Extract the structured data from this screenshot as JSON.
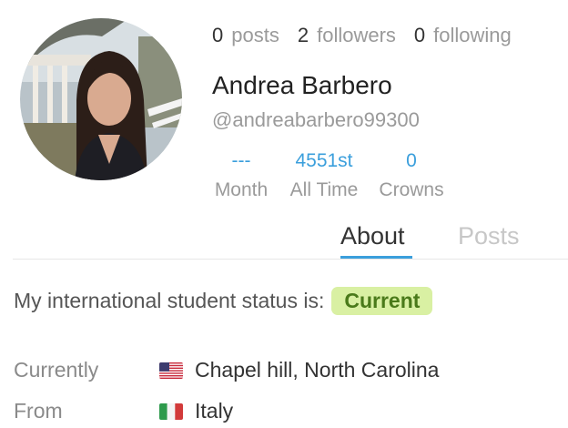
{
  "profile": {
    "posts_count": "0",
    "posts_label": "posts",
    "followers_count": "2",
    "followers_label": "followers",
    "following_count": "0",
    "following_label": "following",
    "name": "Andrea Barbero",
    "handle": "@andreabarbero99300"
  },
  "ranks": [
    {
      "value": "---",
      "label": "Month"
    },
    {
      "value": "4551st",
      "label": "All Time"
    },
    {
      "value": "0",
      "label": "Crowns"
    }
  ],
  "tabs": {
    "about": "About",
    "posts": "Posts",
    "active": "About"
  },
  "about": {
    "status_text": "My international student status is:",
    "status_badge": "Current",
    "rows": [
      {
        "label": "Currently",
        "flag": "us-flag-icon",
        "value": "Chapel hill, North Carolina"
      },
      {
        "label": "From",
        "flag": "italy-flag-icon",
        "value": "Italy"
      }
    ]
  },
  "colors": {
    "accent": "#3b9fdc",
    "badge_bg": "#d9f0a3",
    "badge_text": "#4a7a1a",
    "muted": "#9a9a9a"
  }
}
